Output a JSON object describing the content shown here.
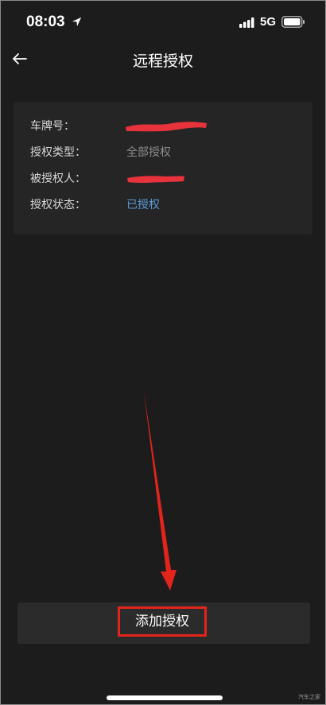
{
  "status_bar": {
    "time": "08:03",
    "network": "5G",
    "location_icon": "location-arrow-icon",
    "signal_icon": "signal-bars-icon",
    "battery_icon": "battery-icon"
  },
  "nav": {
    "title": "远程授权",
    "back_icon": "back-arrow-icon"
  },
  "info": {
    "rows": [
      {
        "label": "车牌号：",
        "value": ""
      },
      {
        "label": "授权类型：",
        "value": "全部授权"
      },
      {
        "label": "被授权人：",
        "value": ""
      },
      {
        "label": "授权状态：",
        "value": "已授权"
      }
    ]
  },
  "actions": {
    "add_auth_label": "添加授权"
  },
  "watermark": "汽车之家",
  "colors": {
    "background": "#1c1c1c",
    "card": "#252525",
    "status_authorized": "#5b9bd5",
    "annotation_red": "#e3241b"
  }
}
